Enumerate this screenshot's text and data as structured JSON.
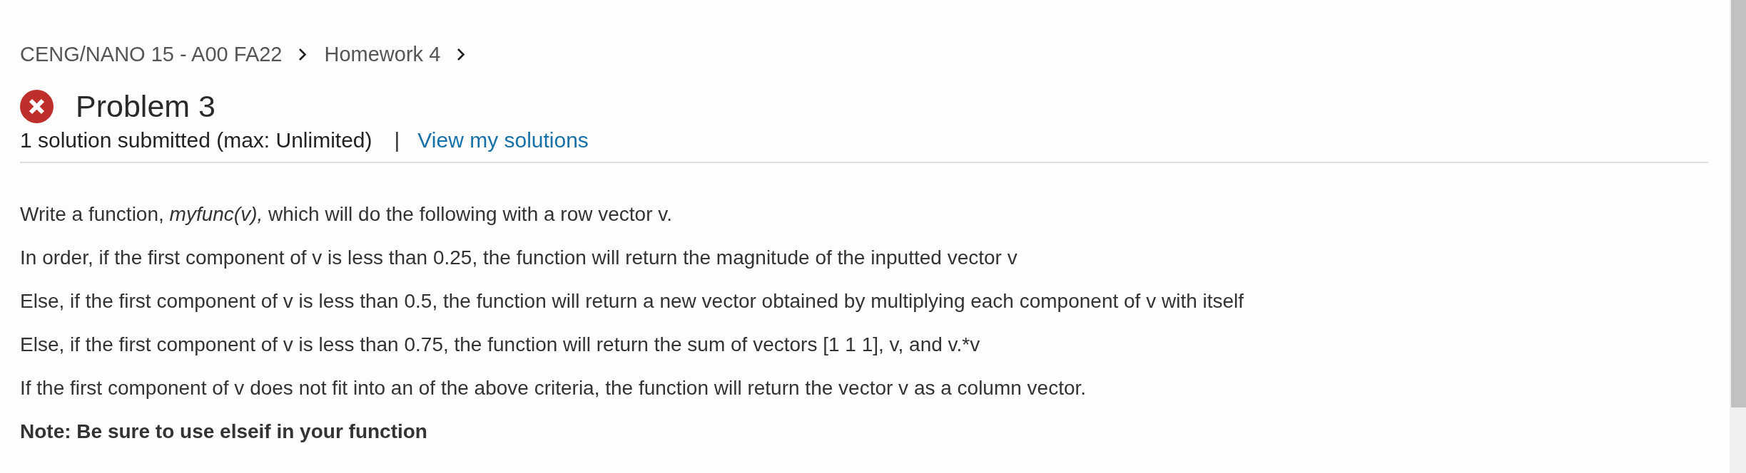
{
  "breadcrumb": [
    {
      "label": "CENG/NANO 15 - A00 FA22"
    },
    {
      "label": "Homework 4"
    }
  ],
  "problem": {
    "correct": false,
    "title": "Problem 3",
    "submissions": "1 solution submitted (max: Unlimited)",
    "separator": "|",
    "link": "View my solutions"
  },
  "paragraphs": [
    {
      "kind": "text",
      "text": "Write a function, *myfunc(v),* which will do the following with a row vector v."
    },
    {
      "kind": "text",
      "text": "In order, if the first component of v is less than 0.25, the function will return the magnitude of the inputted vector v"
    },
    {
      "kind": "text",
      "text": "Else, if the first component of v is less than 0.5, the function will return a new vector obtained by multiplying each component of v with itself"
    },
    {
      "kind": "text",
      "text": "Else, if the first component of v is less than 0.75, the function will return the sum of vectors [1 1 1], v, and v.*v"
    },
    {
      "kind": "text",
      "text": "If the first component of v does not fit into an of the above criteria, the function will return the vector v as a column vector."
    },
    {
      "kind": "note",
      "text": "Note: Be sure to use elseif in your function"
    }
  ]
}
